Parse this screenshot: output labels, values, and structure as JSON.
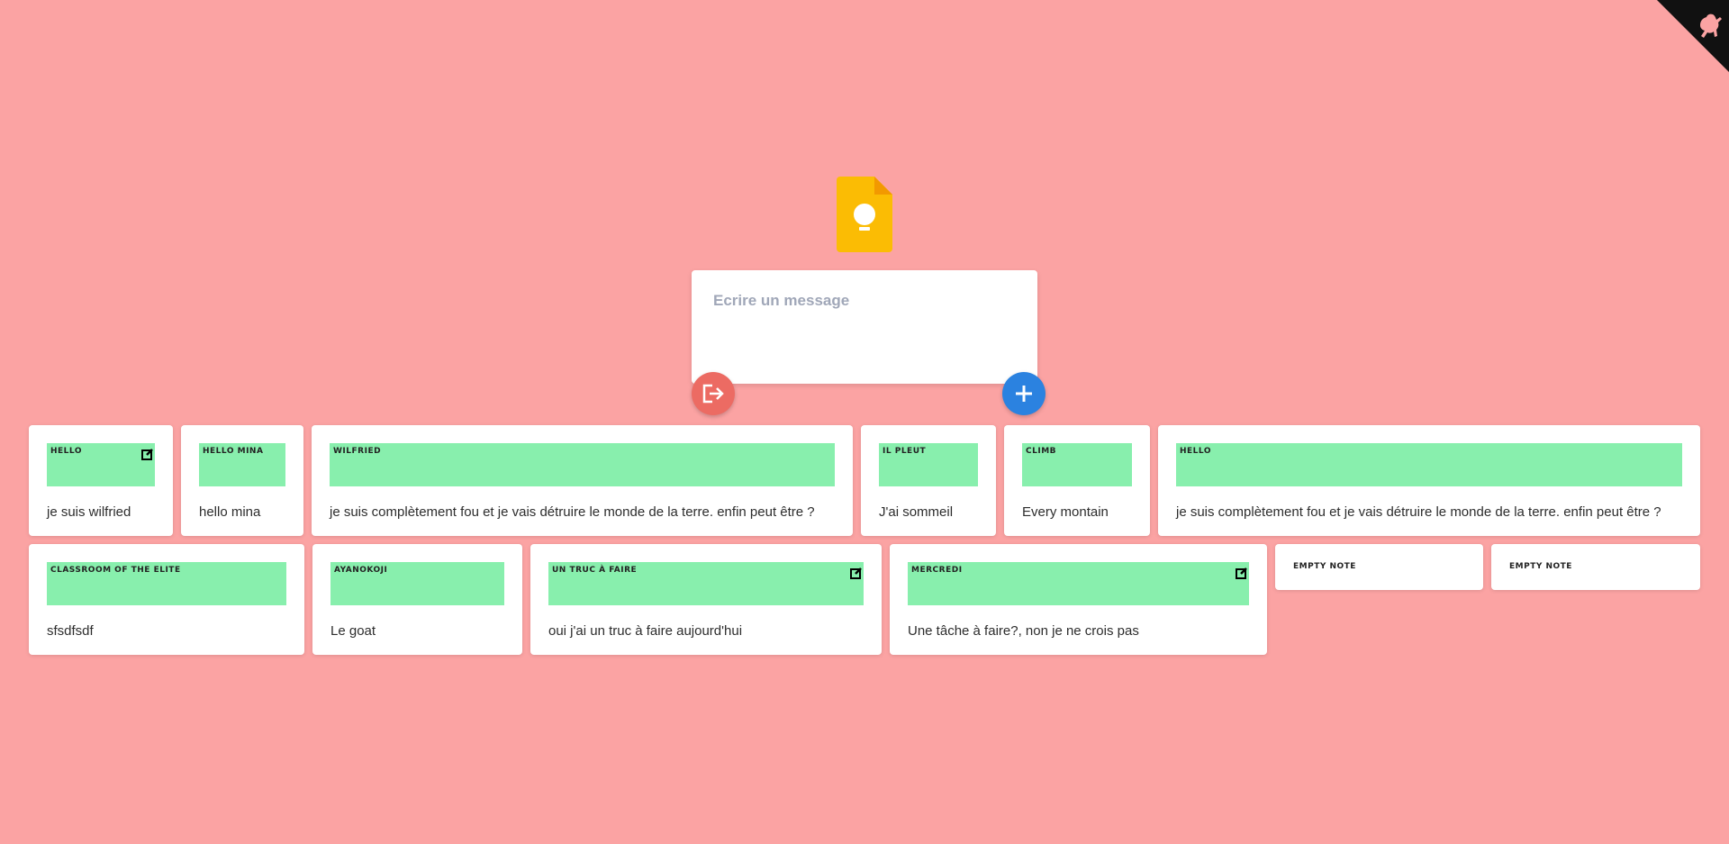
{
  "composer": {
    "placeholder": "Ecrire un message"
  },
  "colors": {
    "background": "#fba3a3",
    "note_header": "#88efad",
    "logout": "#ec6b63",
    "add": "#2b82e0",
    "logo": "#fbbc04"
  },
  "icons": {
    "logo": "lightbulb-note-icon",
    "logout": "logout-icon",
    "add": "plus-icon",
    "edit": "edit-icon",
    "github": "github-cat-icon"
  },
  "notes_row1": [
    {
      "title": "HELLO",
      "body": "je suis wilfried"
    },
    {
      "title": "HELLO MINA",
      "body": "hello mina"
    },
    {
      "title": "WILFRIED",
      "body": "je suis complètement fou et je vais détruire le monde de la terre. enfin peut être ?"
    },
    {
      "title": "IL PLEUT",
      "body": "J'ai sommeil"
    },
    {
      "title": "CLIMB",
      "body": "Every montain"
    },
    {
      "title": "HELLO",
      "body": "je suis complètement fou et je vais détruire le monde de la terre. enfin peut être ?"
    }
  ],
  "notes_row2": [
    {
      "title": "CLASSROOM OF THE ELITE",
      "body": "sfsdfsdf"
    },
    {
      "title": "AYANOKOJI",
      "body": "Le goat"
    },
    {
      "title": "UN TRUC À FAIRE",
      "body": "oui j'ai un truc à faire aujourd'hui"
    },
    {
      "title": "MERCREDI",
      "body": "Une tâche à faire?, non je ne crois pas"
    }
  ],
  "empty_notes": [
    {
      "title": "EMPTY NOTE"
    },
    {
      "title": "EMPTY NOTE"
    }
  ]
}
